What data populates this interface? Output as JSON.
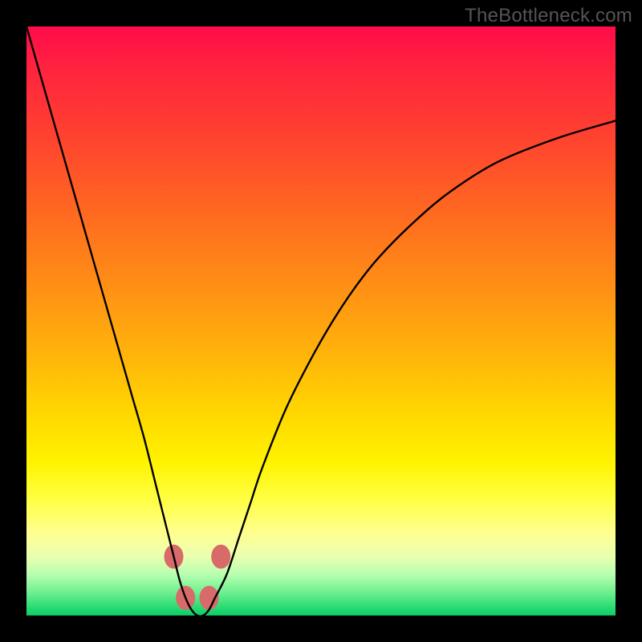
{
  "watermark": "TheBottleneck.com",
  "chart_data": {
    "type": "line",
    "title": "",
    "xlabel": "",
    "ylabel": "",
    "xlim": [
      0,
      100
    ],
    "ylim": [
      0,
      100
    ],
    "grid": false,
    "background_gradient": {
      "top_color": "#ff0b4a",
      "bottom_color": "#10c868",
      "description": "red (high bottleneck) to green (low bottleneck), top-to-bottom"
    },
    "series": [
      {
        "name": "bottleneck-curve",
        "color": "#000000",
        "x": [
          0,
          2,
          4,
          6,
          8,
          10,
          12,
          14,
          16,
          18,
          20,
          22,
          24,
          25,
          26,
          27,
          28,
          29,
          30,
          31,
          32,
          34,
          36,
          38,
          40,
          44,
          48,
          52,
          56,
          60,
          66,
          72,
          80,
          90,
          100
        ],
        "values": [
          100,
          93,
          86,
          79,
          72,
          65,
          58,
          51,
          44,
          37,
          30,
          22,
          14,
          10,
          6,
          3,
          1,
          0,
          0,
          1,
          3,
          7,
          13,
          19,
          25,
          35,
          43,
          50,
          56,
          61,
          67,
          72,
          77,
          81,
          84
        ]
      }
    ],
    "markers": [
      {
        "name": "left-upper-dot",
        "x": 25.0,
        "y": 10,
        "color": "#d86a6a",
        "r": 12
      },
      {
        "name": "left-lower-dot",
        "x": 27.0,
        "y": 3,
        "color": "#d86a6a",
        "r": 12
      },
      {
        "name": "right-lower-dot",
        "x": 31.0,
        "y": 3,
        "color": "#d86a6a",
        "r": 12
      },
      {
        "name": "right-upper-dot",
        "x": 33.0,
        "y": 10,
        "color": "#d86a6a",
        "r": 12
      }
    ]
  }
}
